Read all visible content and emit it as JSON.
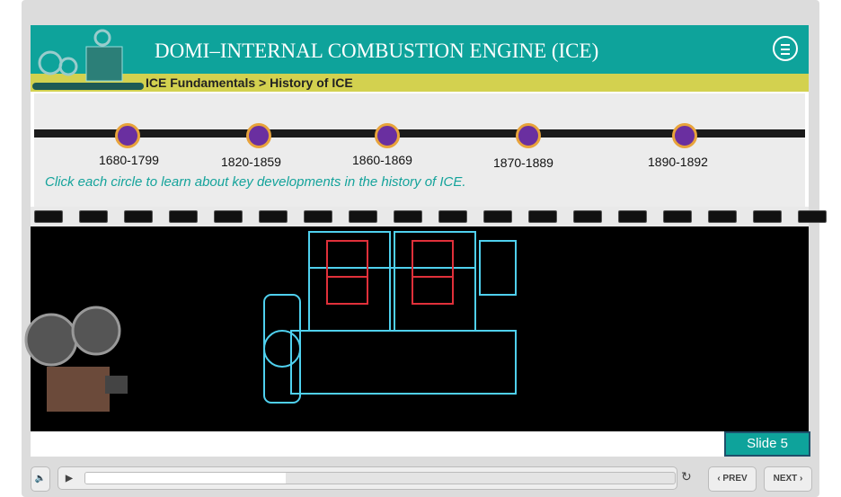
{
  "header": {
    "title": "DOMI–INTERNAL COMBUSTION ENGINE (ICE)",
    "breadcrumb": "ICE Fundamentals > History of ICE"
  },
  "timeline": {
    "periods": [
      "1680-1799",
      "1820-1859",
      "1860-1869",
      "1870-1889",
      "1890-1892"
    ],
    "hint": "Click each circle to learn about key developments in the history of ICE."
  },
  "slide_label": "Slide 5",
  "controls": {
    "prev": "‹ PREV",
    "next": "NEXT ›",
    "progress_percent": 34
  },
  "colors": {
    "header": "#0ea39b",
    "breadcrumb": "#d3d14f",
    "dot": "#6a2fa0",
    "dot_ring": "#e8a33b"
  }
}
